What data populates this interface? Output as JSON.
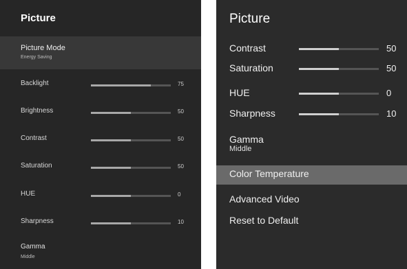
{
  "left": {
    "title": "Picture",
    "picture_mode": {
      "label": "Picture Mode",
      "value": "Energy Saving"
    },
    "sliders": [
      {
        "label": "Backlight",
        "value": "75",
        "level": 0.75
      },
      {
        "label": "Brightness",
        "value": "50",
        "level": 0.5
      },
      {
        "label": "Contrast",
        "value": "50",
        "level": 0.5
      },
      {
        "label": "Saturation",
        "value": "50",
        "level": 0.5
      },
      {
        "label": "HUE",
        "value": "0",
        "level": 0.5
      },
      {
        "label": "Sharpness",
        "value": "10",
        "level": 0.5
      }
    ],
    "gamma": {
      "label": "Gamma",
      "value": "Middle"
    }
  },
  "right": {
    "title": "Picture",
    "sliders": [
      {
        "label": "Contrast",
        "value": "50",
        "level": 0.5
      },
      {
        "label": "Saturation",
        "value": "50",
        "level": 0.5
      },
      {
        "label": "HUE",
        "value": "0",
        "level": 0.5
      },
      {
        "label": "Sharpness",
        "value": "10",
        "level": 0.5
      }
    ],
    "gamma": {
      "label": "Gamma",
      "value": "Middle"
    },
    "menu": [
      {
        "label": "Color Temperature",
        "selected": true
      },
      {
        "label": "Advanced Video",
        "selected": false
      },
      {
        "label": "Reset to Default",
        "selected": false
      }
    ]
  },
  "colors": {
    "panel_bg": "#262626",
    "highlight": "#6a6a6a",
    "slider_fill": "#a8a8a8"
  }
}
